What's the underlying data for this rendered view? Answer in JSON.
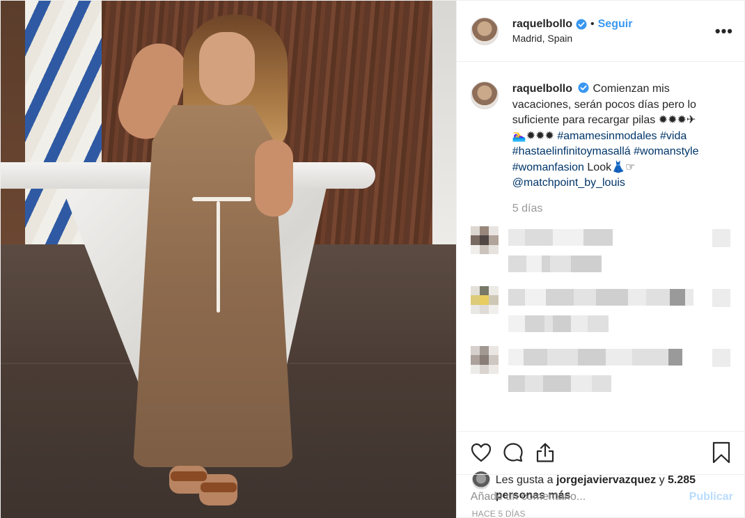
{
  "post": {
    "username": "raquelbollo",
    "follow_label": "Seguir",
    "separator": "•",
    "location": "Madrid, Spain",
    "more_label": "•••",
    "caption_parts": [
      {
        "text": "Comienzan mis vacaciones, serán pocos días pero lo suficiente para recargar pilas ✹✹✹✈ 🏊‍♀️✹✹✹ ",
        "type": "text"
      },
      {
        "text": "#amamesinmodales",
        "type": "tag"
      },
      {
        "text": " ",
        "type": "text"
      },
      {
        "text": "#vida",
        "type": "tag"
      },
      {
        "text": " ",
        "type": "text"
      },
      {
        "text": "#hastaelinfinitoymasallá",
        "type": "tag"
      },
      {
        "text": " ",
        "type": "text"
      },
      {
        "text": "#womanstyle",
        "type": "tag"
      },
      {
        "text": " ",
        "type": "text"
      },
      {
        "text": "#womanfasion",
        "type": "tag"
      },
      {
        "text": " Look👗☞ ",
        "type": "text"
      },
      {
        "text": "@matchpoint_by_louis",
        "type": "tag"
      }
    ],
    "caption_age": "5 días",
    "likes_prefix": "Les gusta a ",
    "likes_user": "jorgejaviervazquez",
    "likes_conj": " y ",
    "likes_count": "5.285 personas más",
    "timestamp": "HACE 5 DÍAS",
    "comment_placeholder": "Añade un comentario...",
    "publish_label": "Publicar"
  },
  "blurred_comments": [
    {
      "avatar": [
        "#d8d2cc",
        "#8d7a6e",
        "#e6e2de",
        "#6b5a50",
        "#3e3230",
        "#a89a90",
        "#efece9",
        "#c7bdb5",
        "#e4e0dc"
      ]
    },
    {
      "avatar": [
        "#e0ddd6",
        "#6a6a58",
        "#ebe8e3",
        "#d9c66a",
        "#e5c84f",
        "#c9c2ae",
        "#e8e6e2",
        "#dcd8d2",
        "#f0eee9"
      ]
    },
    {
      "avatar": [
        "#d2ccc8",
        "#9a8f88",
        "#e8e4e0",
        "#a49891",
        "#7c6f69",
        "#c8c0bb",
        "#ece9e6",
        "#d6d0cc",
        "#eae7e4"
      ]
    }
  ],
  "colors": {
    "accent": "#3897f0",
    "hashtag": "#003569",
    "muted": "#999999",
    "publish_disabled": "#b9dcfc"
  },
  "icons": [
    "verified-badge-icon",
    "heart-icon",
    "comment-icon",
    "share-icon",
    "bookmark-icon",
    "more-icon"
  ]
}
